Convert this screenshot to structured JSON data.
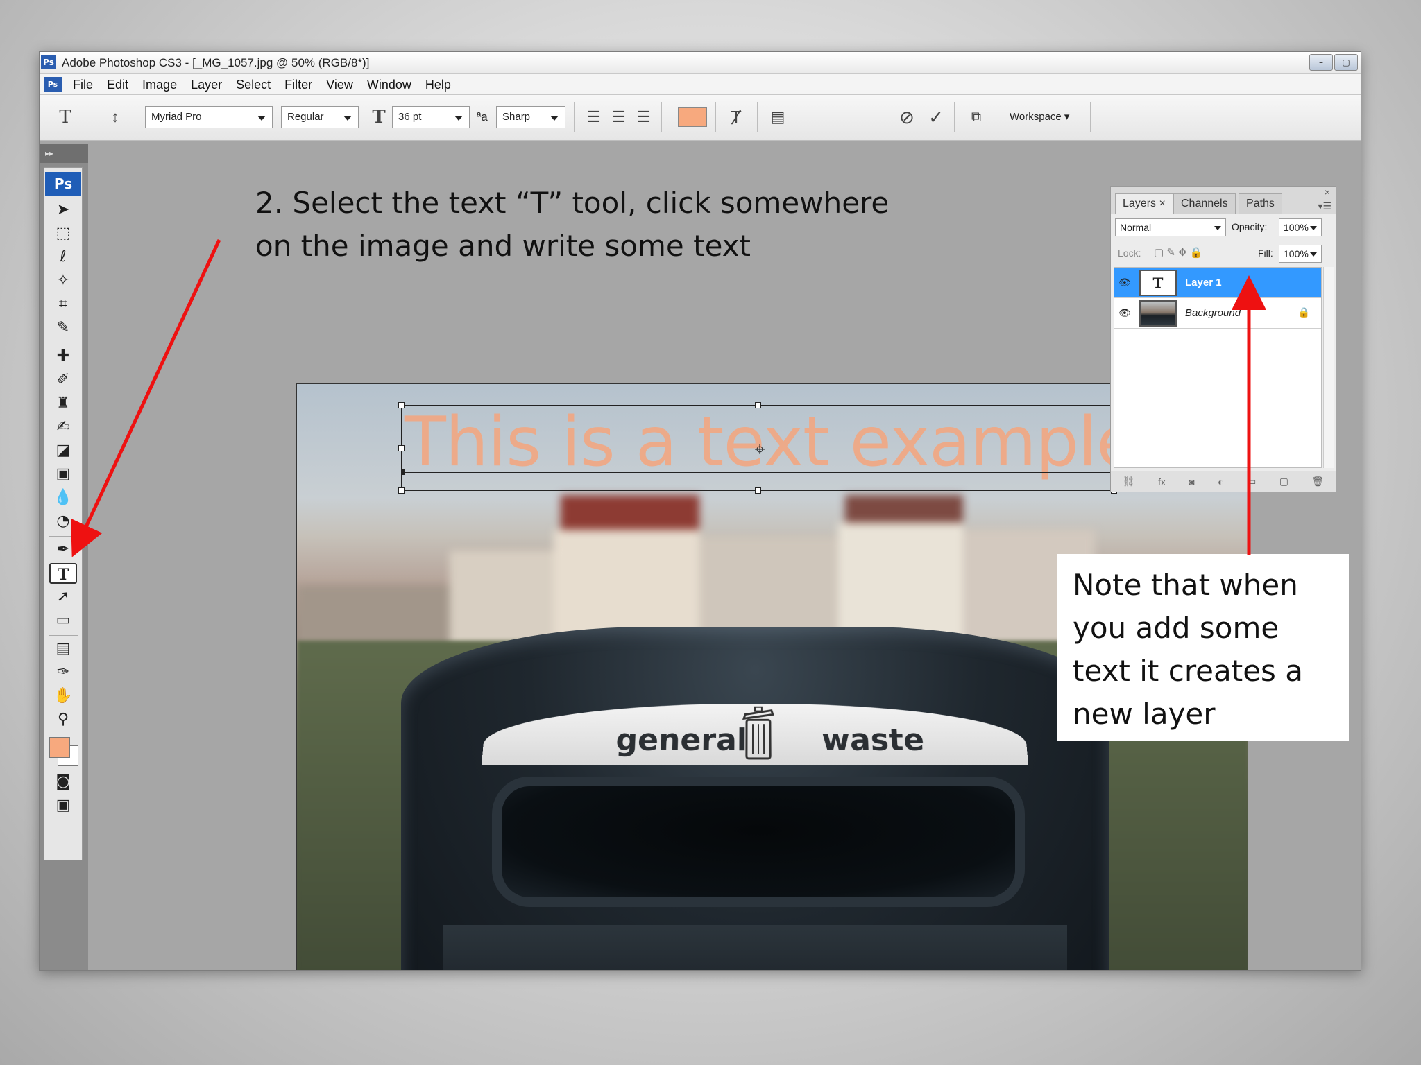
{
  "window": {
    "title": "Adobe Photoshop CS3 - [_MG_1057.jpg @ 50% (RGB/8*)]",
    "app_badge": "Ps",
    "controls": [
      "–",
      "▢"
    ]
  },
  "menubar": {
    "items": [
      "File",
      "Edit",
      "Image",
      "Layer",
      "Select",
      "Filter",
      "View",
      "Window",
      "Help"
    ]
  },
  "options_bar": {
    "font_family": "Myriad Pro",
    "font_style": "Regular",
    "font_size": "36 pt",
    "antialias_prefix": "ªa",
    "antialias": "Sharp",
    "text_color": "#f7a97e",
    "workspace": "Workspace ▾"
  },
  "toolbox": {
    "logo": "Ps",
    "fg_color": "#f7a97e",
    "bg_color": "#ffffff"
  },
  "canvas": {
    "text": "This is a text example",
    "bin_word_left": "general",
    "bin_word_right": "waste"
  },
  "layers_panel": {
    "tabs": [
      "Layers ×",
      "Channels",
      "Paths"
    ],
    "blend_mode": "Normal",
    "opacity_label": "Opacity:",
    "opacity_value": "100%",
    "lock_label": "Lock:",
    "fill_label": "Fill:",
    "fill_value": "100%",
    "layers": [
      {
        "name": "Layer 1",
        "thumb": "T",
        "selected": true
      },
      {
        "name": "Background",
        "thumb": "",
        "selected": false
      }
    ]
  },
  "slide": {
    "instruction": "2. Select the text “T” tool, click somewhere on the image and write some text",
    "note": "Note that when you add some text it creates a new layer",
    "arrow_color": "#ee1111"
  }
}
